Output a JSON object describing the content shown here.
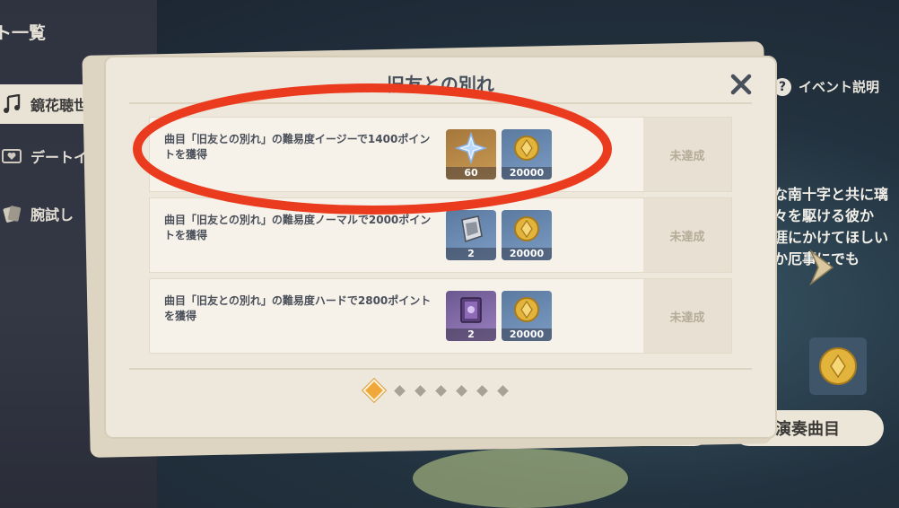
{
  "background": {
    "title": "ト一覧",
    "tabs": [
      {
        "label": "鏡花聴世",
        "icon": "music-note-icon",
        "active": true
      },
      {
        "label": "デートイ",
        "icon": "heart-card-icon",
        "active": false
      },
      {
        "label": "腕試し",
        "icon": "cards-icon",
        "active": false
      }
    ],
    "help_label": "イベント説明",
    "story_lines": [
      "な南十字と共に璃",
      "々を駆ける彼か",
      "涯にかけてほしい",
      "か厄事にでも"
    ],
    "play_button": "演奏曲目"
  },
  "dialog": {
    "title": "旧友との別れ",
    "rows": [
      {
        "description": "曲目「旧友との別れ」の難易度イージーで1400ポイントを獲得",
        "rewards": [
          {
            "icon": "primogem-icon",
            "count": "60"
          },
          {
            "icon": "mora-coin-icon",
            "count": "20000"
          }
        ],
        "status": "未達成"
      },
      {
        "description": "曲目「旧友との別れ」の難易度ノーマルで2000ポイントを獲得",
        "rewards": [
          {
            "icon": "ore-icon",
            "count": "2"
          },
          {
            "icon": "mora-coin-icon",
            "count": "20000"
          }
        ],
        "status": "未達成"
      },
      {
        "description": "曲目「旧友との別れ」の難易度ハードで2800ポイントを獲得",
        "rewards": [
          {
            "icon": "book-icon",
            "count": "2"
          },
          {
            "icon": "mora-coin-icon",
            "count": "20000"
          }
        ],
        "status": "未達成"
      }
    ],
    "pages": {
      "total": 7,
      "current": 1
    }
  },
  "colors": {
    "accent": "#f0a83b",
    "annotation": "#ea3b1e"
  }
}
